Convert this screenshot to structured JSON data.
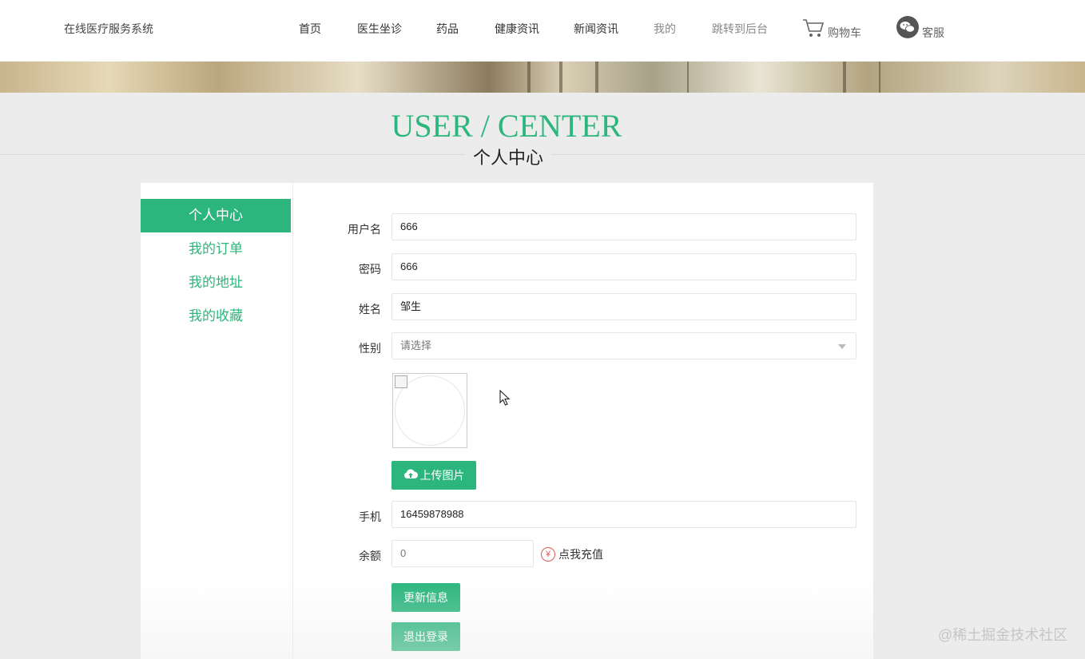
{
  "header": {
    "brand": "在线医疗服务系统",
    "nav": [
      "首页",
      "医生坐诊",
      "药品",
      "健康资讯",
      "新闻资讯",
      "我的",
      "跳转到后台"
    ],
    "cart_label": "购物车",
    "service_label": "客服"
  },
  "banner": {},
  "section": {
    "title_en": "USER / CENTER",
    "title_zh": "个人中心"
  },
  "sidebar": {
    "items": [
      {
        "label": "个人中心",
        "active": true
      },
      {
        "label": "我的订单",
        "active": false
      },
      {
        "label": "我的地址",
        "active": false
      },
      {
        "label": "我的收藏",
        "active": false
      }
    ]
  },
  "form": {
    "username": {
      "label": "用户名",
      "value": "666"
    },
    "password": {
      "label": "密码",
      "value": "666"
    },
    "name": {
      "label": "姓名",
      "value": "邹生"
    },
    "gender": {
      "label": "性别",
      "placeholder": "请选择"
    },
    "upload_label": "上传图片",
    "phone": {
      "label": "手机",
      "value": "16459878988"
    },
    "balance": {
      "label": "余额",
      "value": "0"
    },
    "recharge_label": "点我充值",
    "update_label": "更新信息",
    "logout_label": "退出登录"
  },
  "watermark": "@稀土掘金技术社区",
  "colors": {
    "accent": "#2cb67d",
    "recharge_icon": "#e05a5a"
  },
  "icons": {
    "cart": "cart-icon",
    "service": "wechat-icon",
    "upload": "cloud-upload-icon",
    "recharge": "yen-icon"
  }
}
